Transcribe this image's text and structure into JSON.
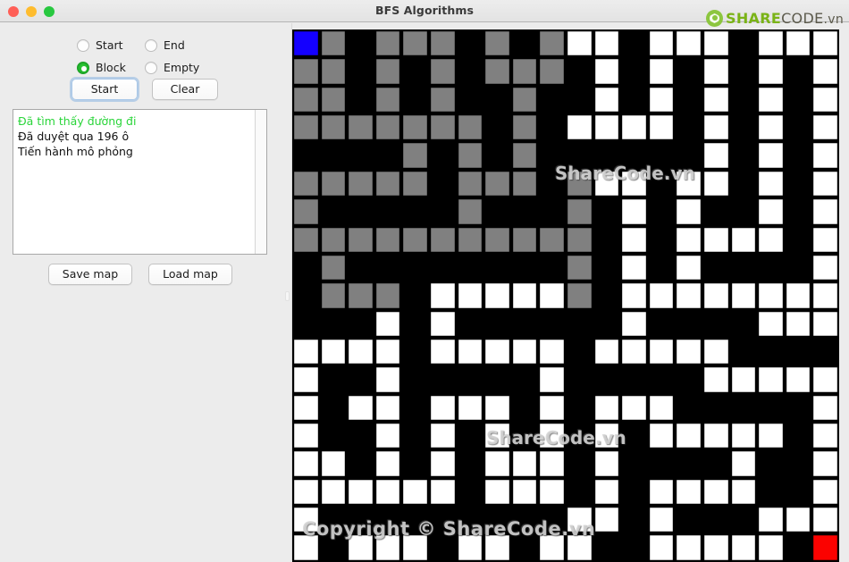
{
  "window": {
    "title": "BFS Algorithms",
    "traffic_lights": [
      "close",
      "minimize",
      "zoom"
    ]
  },
  "brand": {
    "share": "SHARE",
    "code": "CODE",
    "vn": ".vn",
    "mark_icon": "sharecode-logo-icon",
    "green": "#7ab317",
    "dark": "#5c5a4c"
  },
  "controls": {
    "radios": [
      {
        "label": "Start",
        "checked": false
      },
      {
        "label": "End",
        "checked": false
      },
      {
        "label": "Block",
        "checked": true
      },
      {
        "label": "Empty",
        "checked": false
      }
    ],
    "start_button": "Start",
    "clear_button": "Clear",
    "save_map_button": "Save map",
    "load_map_button": "Load map"
  },
  "log": {
    "lines": [
      {
        "text": "Đã tìm thấy đường đi",
        "color": "#2ad53a"
      },
      {
        "text": "Đã duyệt qua 196 ô",
        "color": "#111111"
      },
      {
        "text": "Tiến hành mô phỏng",
        "color": "#111111"
      }
    ]
  },
  "watermarks": [
    {
      "text": "ShareCode.vn"
    },
    {
      "text": "ShareCode.vn"
    },
    {
      "text": "Copyright © ShareCode.vn"
    }
  ],
  "grid": {
    "columns": 20,
    "rows": 19,
    "legend": {
      "b": "wall-black",
      "w": "empty-white",
      "g": "visited-gray",
      "s": "start-blue",
      "e": "end-red"
    },
    "colors": {
      "wall": "#000000",
      "empty": "#ffffff",
      "visited": "#808080",
      "start": "#1400ff",
      "end": "#fb0200"
    },
    "cells": [
      [
        "s",
        "g",
        "b",
        "g",
        "g",
        "g",
        "b",
        "g",
        "b",
        "g",
        "w",
        "w",
        "b",
        "w",
        "w",
        "w",
        "b",
        "w",
        "w",
        "w"
      ],
      [
        "g",
        "g",
        "b",
        "g",
        "b",
        "g",
        "b",
        "g",
        "g",
        "g",
        "b",
        "w",
        "b",
        "w",
        "b",
        "w",
        "b",
        "w",
        "b",
        "w"
      ],
      [
        "g",
        "g",
        "b",
        "g",
        "b",
        "g",
        "b",
        "b",
        "g",
        "b",
        "b",
        "w",
        "b",
        "w",
        "b",
        "w",
        "b",
        "w",
        "b",
        "w"
      ],
      [
        "g",
        "g",
        "g",
        "g",
        "g",
        "g",
        "g",
        "b",
        "g",
        "b",
        "w",
        "w",
        "w",
        "w",
        "b",
        "w",
        "b",
        "w",
        "b",
        "w"
      ],
      [
        "b",
        "b",
        "b",
        "b",
        "g",
        "b",
        "g",
        "b",
        "g",
        "b",
        "b",
        "b",
        "b",
        "b",
        "b",
        "w",
        "b",
        "w",
        "b",
        "w"
      ],
      [
        "g",
        "g",
        "g",
        "g",
        "g",
        "b",
        "g",
        "g",
        "g",
        "b",
        "g",
        "w",
        "w",
        "b",
        "w",
        "w",
        "b",
        "w",
        "b",
        "w"
      ],
      [
        "g",
        "b",
        "b",
        "b",
        "b",
        "b",
        "g",
        "b",
        "b",
        "b",
        "g",
        "b",
        "w",
        "b",
        "w",
        "b",
        "b",
        "w",
        "b",
        "w"
      ],
      [
        "g",
        "g",
        "g",
        "g",
        "g",
        "g",
        "g",
        "g",
        "g",
        "g",
        "g",
        "b",
        "w",
        "b",
        "w",
        "w",
        "w",
        "w",
        "b",
        "w"
      ],
      [
        "b",
        "g",
        "b",
        "b",
        "b",
        "b",
        "b",
        "b",
        "b",
        "b",
        "g",
        "b",
        "w",
        "b",
        "w",
        "b",
        "b",
        "b",
        "b",
        "w"
      ],
      [
        "b",
        "g",
        "g",
        "g",
        "b",
        "w",
        "w",
        "w",
        "w",
        "w",
        "g",
        "b",
        "w",
        "w",
        "w",
        "w",
        "w",
        "w",
        "w",
        "w"
      ],
      [
        "b",
        "b",
        "b",
        "w",
        "b",
        "w",
        "b",
        "b",
        "b",
        "b",
        "b",
        "b",
        "w",
        "b",
        "b",
        "b",
        "b",
        "w",
        "w",
        "w"
      ],
      [
        "w",
        "w",
        "w",
        "w",
        "b",
        "w",
        "w",
        "w",
        "w",
        "w",
        "b",
        "w",
        "w",
        "w",
        "w",
        "w",
        "b",
        "b",
        "b",
        "b"
      ],
      [
        "w",
        "b",
        "b",
        "w",
        "b",
        "b",
        "b",
        "b",
        "b",
        "w",
        "b",
        "b",
        "b",
        "b",
        "b",
        "w",
        "w",
        "w",
        "w",
        "w"
      ],
      [
        "w",
        "b",
        "w",
        "w",
        "b",
        "w",
        "w",
        "w",
        "b",
        "w",
        "b",
        "w",
        "w",
        "w",
        "b",
        "b",
        "b",
        "b",
        "b",
        "w"
      ],
      [
        "w",
        "b",
        "b",
        "w",
        "b",
        "w",
        "b",
        "w",
        "b",
        "w",
        "b",
        "w",
        "b",
        "w",
        "w",
        "w",
        "w",
        "w",
        "b",
        "w"
      ],
      [
        "w",
        "w",
        "b",
        "w",
        "b",
        "w",
        "b",
        "w",
        "w",
        "w",
        "b",
        "w",
        "b",
        "b",
        "b",
        "b",
        "w",
        "b",
        "b",
        "w"
      ],
      [
        "w",
        "w",
        "w",
        "w",
        "w",
        "w",
        "b",
        "w",
        "w",
        "w",
        "b",
        "w",
        "b",
        "w",
        "w",
        "w",
        "w",
        "b",
        "b",
        "w"
      ],
      [
        "w",
        "b",
        "b",
        "b",
        "b",
        "b",
        "b",
        "b",
        "b",
        "b",
        "w",
        "w",
        "b",
        "w",
        "b",
        "b",
        "b",
        "w",
        "w",
        "w"
      ],
      [
        "w",
        "b",
        "w",
        "w",
        "w",
        "b",
        "w",
        "w",
        "b",
        "w",
        "w",
        "b",
        "b",
        "w",
        "w",
        "w",
        "w",
        "w",
        "b",
        "e"
      ]
    ]
  }
}
